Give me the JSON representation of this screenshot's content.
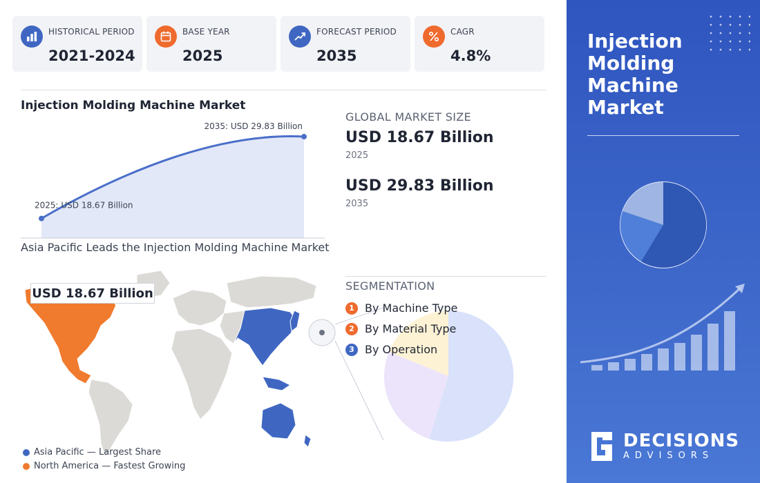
{
  "stats": [
    {
      "label": "HISTORICAL PERIOD",
      "value": "2021-2024",
      "icon": "bar-chart-icon",
      "color": "#3f67c2"
    },
    {
      "label": "BASE YEAR",
      "value": "2025",
      "icon": "calendar-icon",
      "color": "#ef6a2d"
    },
    {
      "label": "FORECAST PERIOD",
      "value": "2035",
      "icon": "trend-up-icon",
      "color": "#3f67c2"
    },
    {
      "label": "CAGR",
      "value": "4.8%",
      "icon": "percent-icon",
      "color": "#ef6a2d"
    }
  ],
  "chart": {
    "title": "Injection Molding Machine Market",
    "start_label": "2025: USD 18.67 Billion",
    "end_label": "2035: USD 29.83 Billion"
  },
  "chart_data": {
    "type": "area",
    "title": "Injection Molding Machine Market",
    "x": [
      2025,
      2035
    ],
    "series": [
      {
        "values": [
          18.67,
          29.83
        ]
      }
    ],
    "annotations": [
      "2025: USD 18.67 Billion",
      "2035: USD 29.83 Billion"
    ],
    "color": "#4a6fc9",
    "fill": "#e3e8f8"
  },
  "market_size": {
    "label": "GLOBAL MARKET SIZE",
    "items": [
      {
        "value": "USD 18.67 Billion",
        "year": "2025"
      },
      {
        "value": "USD 29.83 Billion",
        "year": "2035"
      }
    ]
  },
  "map": {
    "title": "Asia Pacific Leads the Injection Molding Machine Market",
    "callout": "USD 18.67 Billion",
    "legend": [
      {
        "label": "Asia Pacific — Largest Share",
        "color": "#3f67c2"
      },
      {
        "label": "North America — Fastest Growing",
        "color": "#f07a2d"
      }
    ]
  },
  "segmentation": {
    "label": "SEGMENTATION",
    "items": [
      {
        "num": "1",
        "label": "By Machine Type",
        "color": "#ef6a2d"
      },
      {
        "num": "2",
        "label": "By Material Type",
        "color": "#ef6a2d"
      },
      {
        "num": "3",
        "label": "By Operation",
        "color": "#3f67c2"
      }
    ]
  },
  "banner": {
    "title": "Injection Molding Machine Market",
    "logo_main": "DECISIONS",
    "logo_sub": "ADVISORS"
  }
}
